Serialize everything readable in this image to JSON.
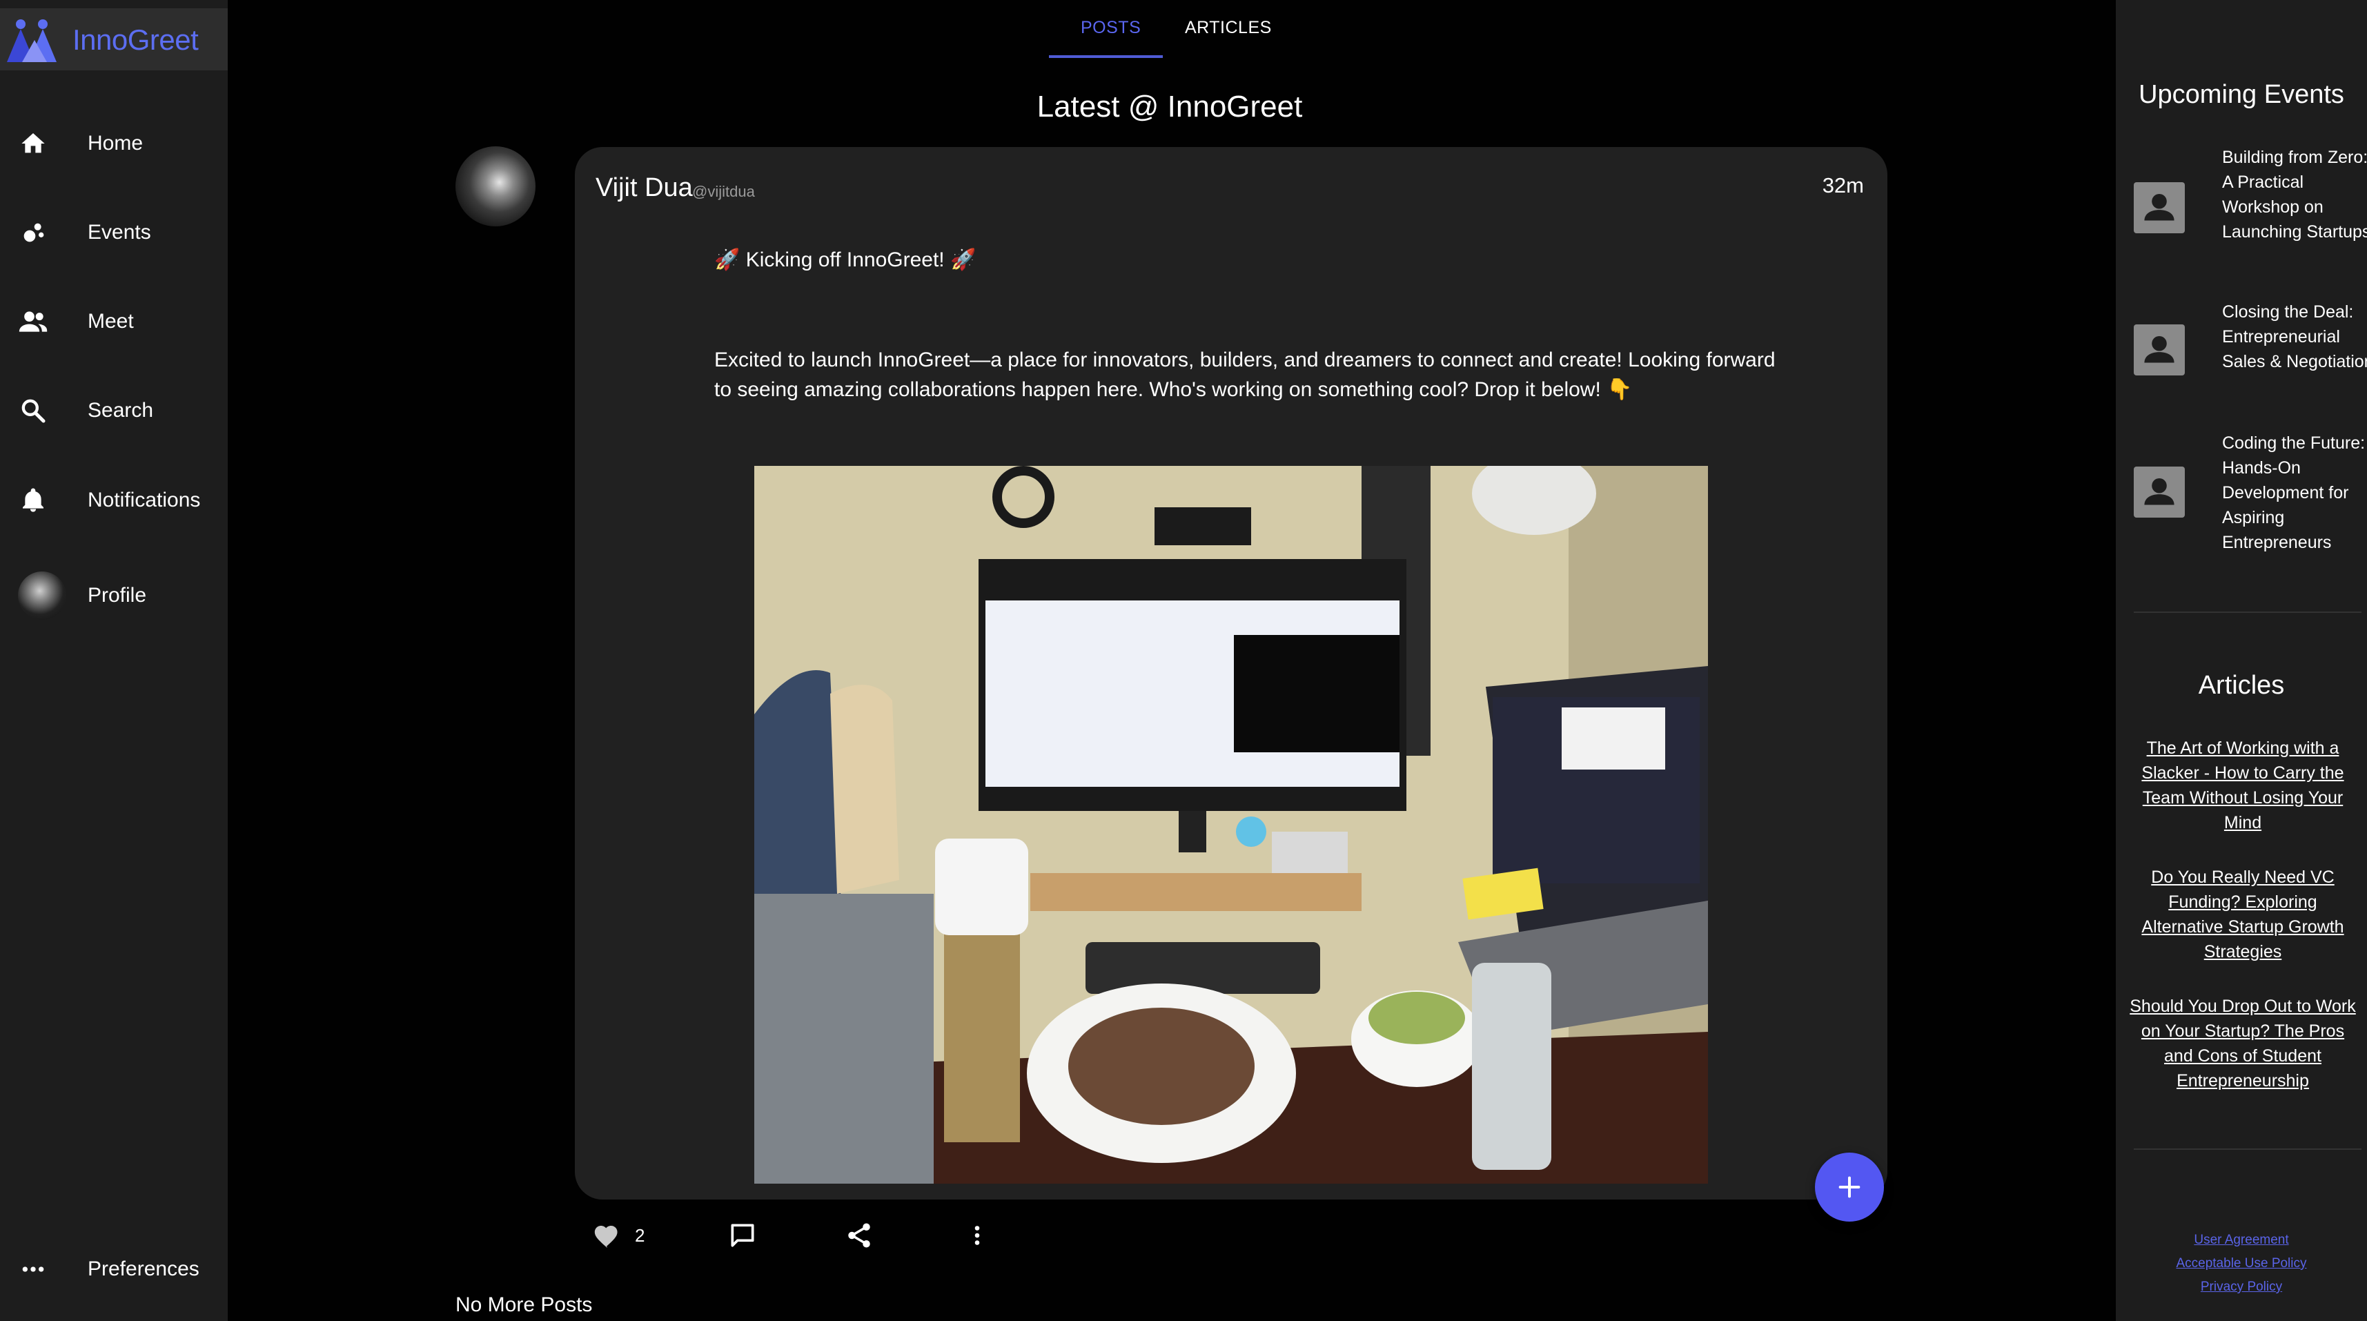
{
  "app": {
    "name": "InnoGreet",
    "accent": "#5357f2"
  },
  "sidebar": {
    "items": [
      {
        "label": "Home",
        "icon": "home-icon"
      },
      {
        "label": "Events",
        "icon": "events-icon"
      },
      {
        "label": "Meet",
        "icon": "people-icon"
      },
      {
        "label": "Search",
        "icon": "search-icon"
      },
      {
        "label": "Notifications",
        "icon": "bell-icon"
      },
      {
        "label": "Profile",
        "icon": "avatar"
      }
    ],
    "preferences_label": "Preferences"
  },
  "main": {
    "tabs": [
      {
        "label": "POSTS",
        "active": true
      },
      {
        "label": "ARTICLES",
        "active": false
      }
    ],
    "title": "Latest @ InnoGreet",
    "post": {
      "author": "Vijit Dua",
      "handle": "@vijitdua",
      "time": "32m",
      "line1": "🚀 Kicking off InnoGreet! 🚀",
      "body": "Excited to launch InnoGreet—a place for innovators, builders, and dreamers to connect and create! Looking forward to seeing amazing collaborations happen here. Who's working on something cool? Drop it below! 👇",
      "likes": "2"
    },
    "end_text": "No More Posts"
  },
  "right_panel": {
    "events_title": "Upcoming Events",
    "events": [
      "Building from Zero: A Practical Workshop on Launching Startups",
      "Closing the Deal: Entrepreneurial Sales & Negotiation",
      "Coding the Future: Hands-On Development for Aspiring Entrepreneurs"
    ],
    "articles_title": "Articles",
    "articles": [
      "The Art of Working with a Slacker - How to Carry the Team Without Losing Your Mind",
      "Do You Really Need VC Funding? Exploring Alternative Startup Growth Strategies",
      "Should You Drop Out to Work on Your Startup? The Pros and Cons of Student Entrepreneurship"
    ],
    "legal": [
      "User Agreement",
      "Acceptable Use Policy",
      "Privacy Policy"
    ]
  }
}
